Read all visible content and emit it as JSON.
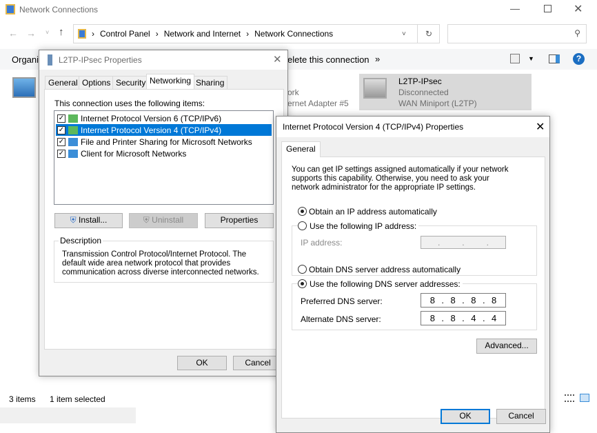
{
  "explorer": {
    "title": "Network Connections",
    "breadcrumb": [
      "Control Panel",
      "Network and Internet",
      "Network Connections"
    ],
    "toolbar": {
      "organize": "Organiz",
      "delete": "elete this connection",
      "more": "»"
    },
    "connections": [
      {
        "name": "",
        "status": "ork",
        "device": "ernet Adapter #5"
      },
      {
        "name": "L2TP-IPsec",
        "status": "Disconnected",
        "device": "WAN Miniport (L2TP)"
      }
    ],
    "status": {
      "items": "3 items",
      "selected": "1 item selected"
    }
  },
  "l2tp": {
    "title": "L2TP-IPsec Properties",
    "tabs": [
      "General",
      "Options",
      "Security",
      "Networking",
      "Sharing"
    ],
    "active_tab": "Networking",
    "items_label": "This connection uses the following items:",
    "items": [
      {
        "label": "Internet Protocol Version 6 (TCP/IPv6)",
        "checked": true
      },
      {
        "label": "Internet Protocol Version 4 (TCP/IPv4)",
        "checked": true,
        "selected": true
      },
      {
        "label": "File and Printer Sharing for Microsoft Networks",
        "checked": true
      },
      {
        "label": "Client for Microsoft Networks",
        "checked": true
      }
    ],
    "install": "Install...",
    "uninstall": "Uninstall",
    "properties": "Properties",
    "description_label": "Description",
    "description": "Transmission Control Protocol/Internet Protocol. The default wide area network protocol that provides communication across diverse interconnected networks.",
    "ok": "OK",
    "cancel": "Cancel"
  },
  "ipv4": {
    "title": "Internet Protocol Version 4 (TCP/IPv4) Properties",
    "tab": "General",
    "intro": "You can get IP settings assigned automatically if your network supports this capability. Otherwise, you need to ask your network administrator for the appropriate IP settings.",
    "obtain_ip": "Obtain an IP address automatically",
    "use_ip": "Use the following IP address:",
    "ip_label": "IP address:",
    "obtain_dns": "Obtain DNS server address automatically",
    "use_dns": "Use the following DNS server addresses:",
    "preferred_label": "Preferred DNS server:",
    "preferred": [
      "8",
      "8",
      "8",
      "8"
    ],
    "alternate_label": "Alternate DNS server:",
    "alternate": [
      "8",
      "8",
      "4",
      "4"
    ],
    "advanced": "Advanced...",
    "ok": "OK",
    "cancel": "Cancel"
  },
  "colors": {
    "selection": "#0078d7",
    "accent": "#0078d7"
  }
}
